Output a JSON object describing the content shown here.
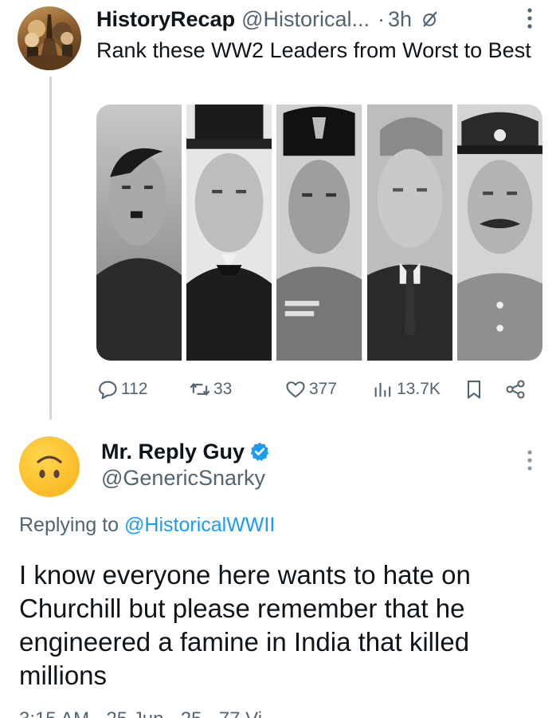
{
  "tweet": {
    "author_name": "HistoryRecap",
    "author_handle": "@Historical...",
    "separator": "·",
    "time": "3h",
    "text": "Rank these WW2 Leaders from Worst to Best",
    "icons": {
      "grok": "slashed-circle-icon",
      "more": "more-vertical-icon"
    },
    "stats": {
      "replies": "112",
      "reposts": "33",
      "likes": "377",
      "views": "13.7K"
    }
  },
  "reply": {
    "author_name": "Mr. Reply Guy",
    "author_handle": "@GenericSnarky",
    "verified": true,
    "replying_to_prefix": "Replying to ",
    "replying_to_handle": "@HistoricalWWII",
    "text": "I know everyone here wants to hate on Churchill but please remember that he engineered a famine in India that killed millions",
    "footer_partial": "3:15 AM · 25 Jun · 25 · 77 Vi"
  },
  "colors": {
    "text": "#0f1419",
    "secondary": "#536471",
    "link": "#1d9bf0",
    "thread_line": "#cfd9de"
  }
}
